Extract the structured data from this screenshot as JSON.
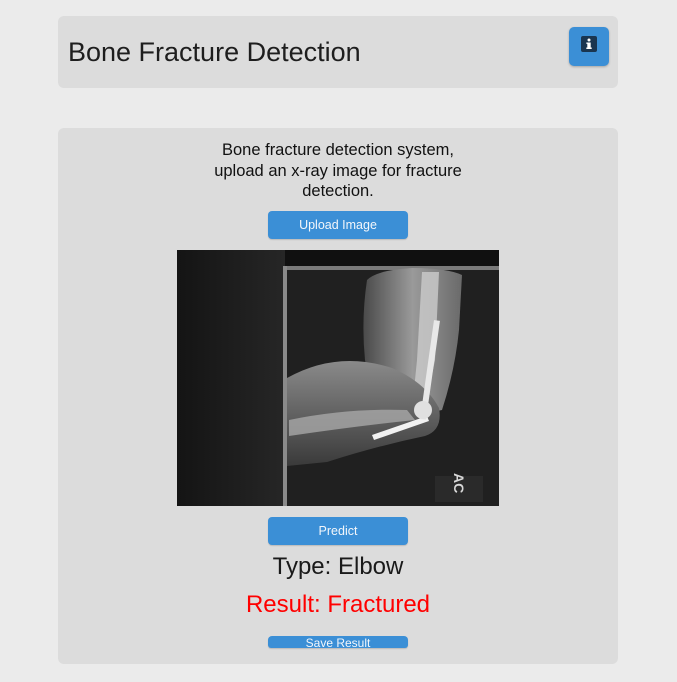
{
  "header": {
    "title": "Bone Fracture Detection",
    "info_icon": "info-icon"
  },
  "main": {
    "description": "Bone fracture detection system, upload an x-ray image for fracture detection.",
    "upload_label": "Upload Image",
    "image": "elbow-xray",
    "xray_marker": "AC",
    "predict_label": "Predict",
    "type_text": "Type: Elbow",
    "result_text": "Result: Fractured",
    "result_color": "#ff0000",
    "save_label": "Save Result"
  },
  "colors": {
    "accent": "#3b8fd6",
    "card": "#dcdcdc",
    "background": "#ebebeb"
  }
}
